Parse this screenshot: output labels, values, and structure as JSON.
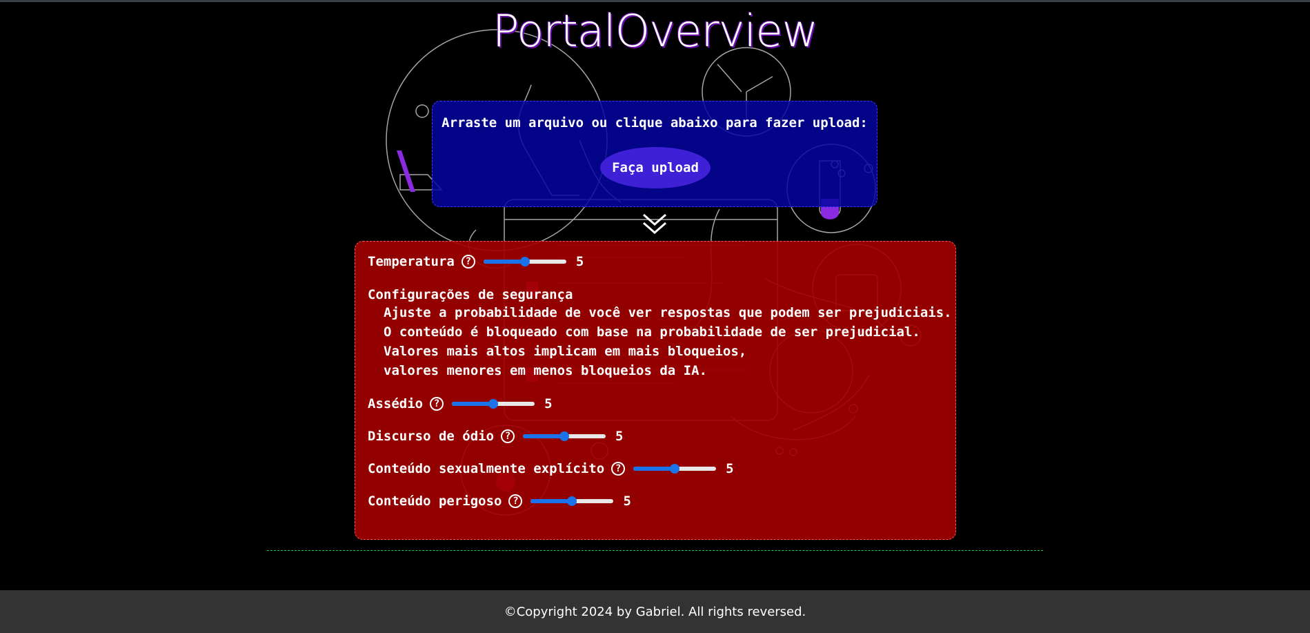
{
  "header": {
    "title": "PortalOverview"
  },
  "upload": {
    "instruction": "Arraste um arquivo ou clique abaixo para fazer upload:",
    "button_label": "Faça upload"
  },
  "settings": {
    "temperature": {
      "label": "Temperatura",
      "help": "?",
      "value": 5,
      "max": 10
    },
    "safety": {
      "title": "Configurações de segurança",
      "lines": [
        "Ajuste a probabilidade de você ver respostas que podem ser prejudiciais.",
        "O conteúdo é bloqueado com base na probabilidade de ser prejudicial.",
        "Valores mais altos implicam em mais bloqueios,",
        "valores menores em menos bloqueios da IA."
      ]
    },
    "sliders": [
      {
        "label": "Assédio",
        "help": "?",
        "value": 5,
        "max": 10
      },
      {
        "label": "Discurso de ódio",
        "help": "?",
        "value": 5,
        "max": 10
      },
      {
        "label": "Conteúdo sexualmente explícito",
        "help": "?",
        "value": 5,
        "max": 10
      },
      {
        "label": "Conteúdo perigoso",
        "help": "?",
        "value": 5,
        "max": 10
      }
    ]
  },
  "footer": {
    "text": "©Copyright 2024 by Gabriel. All rights reversed."
  },
  "colors": {
    "upload_bg": "#0505a0",
    "upload_button": "#3e20d6",
    "settings_bg": "#a00000",
    "slider_accent": "#1a73e8",
    "divider": "#22c55e",
    "footer_bg": "#333333"
  }
}
